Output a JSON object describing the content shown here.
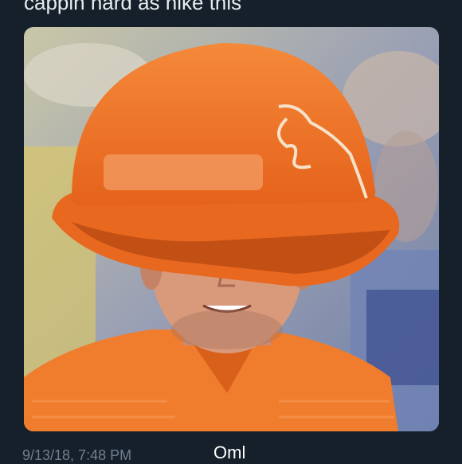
{
  "tweet": {
    "text": "cappin hard as hike this",
    "timestamp": "9/13/18, 7:48 PM"
  },
  "overlay": {
    "caption": "Oml"
  },
  "colors": {
    "background": "#15202b",
    "hat_orange": "#ef7a2a",
    "shirt_orange": "#f07c2e"
  }
}
